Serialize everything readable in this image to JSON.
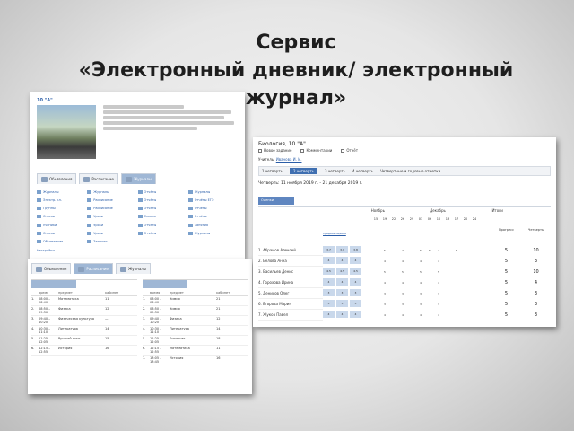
{
  "title_line1": "Сервис",
  "title_line2": "«Электронный дневник/ электронный",
  "title_line3": "журнал»",
  "school_profile": {
    "class_title": "10 \"А\"",
    "tabs": [
      "Обьявления",
      "Расписание",
      "Журналы"
    ],
    "links": [
      "Журналы",
      "Журналы",
      "Отчёты",
      "Журналы",
      "Электр. кл.",
      "Расписание",
      "Отчёты",
      "Отчёты ЕГЭ",
      "Группы",
      "Расписание",
      "Отчёты",
      "Отчёты",
      "Списки",
      "Уроки",
      "Списки",
      "Отчёты",
      "Ученики",
      "Уроки",
      "Отчёты",
      "Занятия",
      "Списки",
      "Уроки",
      "Отчёты",
      "Журналы",
      "Обьявления",
      "Занятия"
    ],
    "settings_link": "Настройки",
    "tab_colors": {
      "active": "#9fb7d5",
      "idle": "#eef1f5"
    }
  },
  "schedule": {
    "tabs": [
      "Обьявления",
      "Расписание",
      "Журналы"
    ],
    "headers": [
      "",
      "время",
      "предмет",
      "кабинет"
    ],
    "left_rows": [
      [
        "1.",
        "08:00 – 08:40",
        "Математика",
        "11"
      ],
      [
        "2.",
        "08:50 – 09:30",
        "Физика",
        "12"
      ],
      [
        "3.",
        "09:40 – 10:20",
        "Физическая культура",
        "—"
      ],
      [
        "4.",
        "10:30 – 11:10",
        "Литература",
        "14"
      ],
      [
        "5.",
        "11:25 – 12:05",
        "Русский язык",
        "15"
      ],
      [
        "6.",
        "12:15 – 12:55",
        "История",
        "16"
      ]
    ],
    "right_rows": [
      [
        "1.",
        "08:00 – 08:40",
        "Химия",
        "21"
      ],
      [
        "2.",
        "08:50 – 09:30",
        "Химия",
        "21"
      ],
      [
        "3.",
        "09:40 – 10:20",
        "Физика",
        "12"
      ],
      [
        "4.",
        "10:30 – 11:10",
        "Литература",
        "14"
      ],
      [
        "5.",
        "11:25 – 12:05",
        "Биология",
        "18"
      ],
      [
        "6.",
        "12:15 – 12:55",
        "Математика",
        "11"
      ],
      [
        "7.",
        "13:05 – 13:45",
        "История",
        "16"
      ]
    ]
  },
  "journal": {
    "title": "Биология, 10 \"А\"",
    "buttons": [
      "Новое задание",
      "Комментарии",
      "Отчёт"
    ],
    "teacher_label": "Учитель:",
    "teacher_name": "Иванова И. И.",
    "quarters": [
      "1 четверть",
      "2 четверть",
      "3 четверть",
      "4 четверть",
      "Четвертные и годовые отметки"
    ],
    "period": "Четверть: 11 ноября 2019 г. - 21 декабря 2019 г.",
    "subtab": "Оценки",
    "months": [
      "Ноябрь",
      "Декабрь",
      "Итоги"
    ],
    "dates": [
      "15",
      "19",
      "22",
      "26",
      "29",
      "03",
      "06",
      "10",
      "13",
      "17",
      "20",
      "24"
    ],
    "grades_header": "Средняя оценка",
    "students": [
      "1. Абрамов Алексей",
      "2. Белова Анна",
      "3. Васильев Денис",
      "4. Горохова Ирина",
      "5. Денисов Олег",
      "6. Егорова Мария",
      "7. Жуков Павел"
    ],
    "grade_values": [
      [
        "3.7",
        "3.9",
        "3.8"
      ],
      [
        "4",
        "4",
        "4"
      ],
      [
        "4.5",
        "4.5",
        "4.5"
      ],
      [
        "4",
        "4",
        "4"
      ],
      [
        "3",
        "3",
        "3"
      ],
      [
        "3",
        "3",
        "3"
      ],
      [
        "4",
        "4",
        "4"
      ]
    ],
    "marks": [
      [
        "",
        "5",
        "",
        "4",
        "",
        "5",
        "5",
        "4",
        "",
        "5",
        "",
        ""
      ],
      [
        "",
        "4",
        "",
        "4",
        "",
        "4",
        "",
        "4",
        "",
        "",
        "",
        ""
      ],
      [
        "",
        "5",
        "",
        "5",
        "",
        "5",
        "",
        "5",
        "",
        "",
        "",
        ""
      ],
      [
        "",
        "4",
        "",
        "4",
        "",
        "4",
        "",
        "4",
        "",
        "",
        "",
        ""
      ],
      [
        "",
        "3",
        "",
        "3",
        "",
        "3",
        "",
        "3",
        "",
        "",
        "",
        ""
      ],
      [
        "",
        "3",
        "",
        "3",
        "",
        "3",
        "",
        "3",
        "",
        "",
        "",
        ""
      ],
      [
        "",
        "4",
        "",
        "4",
        "",
        "4",
        "",
        "4",
        "",
        "",
        "",
        ""
      ]
    ],
    "final_headers": [
      "Прогресс",
      "Четверть"
    ],
    "finals": [
      [
        "5",
        "10"
      ],
      [
        "5",
        "3"
      ],
      [
        "5",
        "10"
      ],
      [
        "5",
        "4"
      ],
      [
        "5",
        "3"
      ],
      [
        "5",
        "3"
      ],
      [
        "5",
        "3"
      ]
    ]
  }
}
